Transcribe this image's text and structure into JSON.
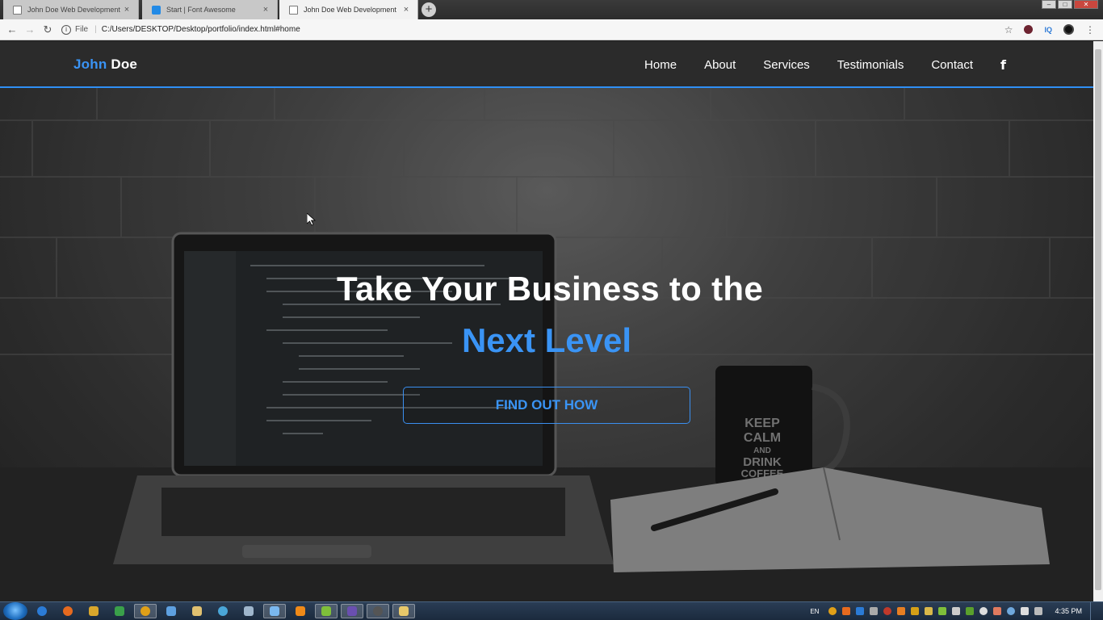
{
  "browser": {
    "tabs": [
      {
        "title": "John Doe Web Development",
        "icon": "document-icon",
        "active": false
      },
      {
        "title": "Start | Font Awesome",
        "icon": "font-awesome-icon",
        "active": false
      },
      {
        "title": "John Doe Web Development",
        "icon": "document-icon",
        "active": true
      }
    ],
    "close_glyph": "×",
    "new_tab_glyph": "+",
    "window_buttons": {
      "minimize": "–",
      "maximize": "□",
      "close": "✕"
    },
    "address": {
      "scheme_label": "File",
      "url": "C:/Users/DESKTOP/Desktop/portfolio/index.html#home"
    },
    "extensions": {
      "iq": "IQ"
    }
  },
  "site": {
    "brand": {
      "first": "John",
      "last": "Doe"
    },
    "nav": [
      {
        "label": "Home"
      },
      {
        "label": "About"
      },
      {
        "label": "Services"
      },
      {
        "label": "Testimonials"
      },
      {
        "label": "Contact"
      }
    ],
    "social_icon": "facebook-icon",
    "social_glyph": "f",
    "hero": {
      "headline": "Take Your Business to the",
      "subline": "Next Level",
      "cta_label": "FIND OUT HOW"
    },
    "colors": {
      "accent": "#3a94f5",
      "navbar": "#2b2b2b",
      "text": "#ffffff"
    }
  },
  "taskbar": {
    "lang": "EN",
    "time": "4:35 PM"
  }
}
